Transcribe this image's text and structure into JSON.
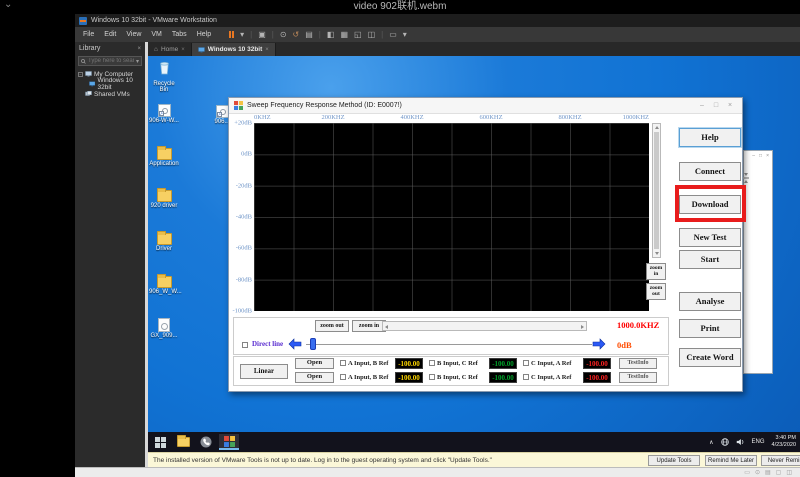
{
  "colors": {
    "desktop_blue": "#1173d4",
    "annotation_red": "#e81c1c",
    "readout_freq_red": "#ff0000",
    "readout_db_orange": "#ff4b00",
    "value_yellow": "#ffd800",
    "value_green": "#00a32a",
    "value_red": "#ff2222",
    "direct_line_purple": "#5a2dd0",
    "nav_arrow_blue": "#2b59f5",
    "axis_label_blue": "#6f95c8",
    "notification_yellow": "#fbf7d8"
  },
  "icons": {
    "video_collapse": "⌄",
    "close": "×",
    "minimize": "–",
    "maximize": "□",
    "dropdown": "▾",
    "home": "⌂",
    "tree_collapse": "−",
    "tray_chevron": "∧"
  },
  "video": {
    "title": "video 902联机.webm"
  },
  "vmware": {
    "title": "Windows 10 32bit - VMware Workstation",
    "menu": [
      "File",
      "Edit",
      "View",
      "VM",
      "Tabs",
      "Help"
    ],
    "toolbar": [
      {
        "name": "suspend-button",
        "glyph": ""
      },
      {
        "name": "send-ctrl-alt-del-icon",
        "glyph": "▣"
      },
      {
        "name": "take-snapshot-icon",
        "glyph": "⊙"
      },
      {
        "name": "revert-snapshot-icon",
        "glyph": "↺"
      },
      {
        "name": "snapshot-manager-icon",
        "glyph": "▤"
      },
      {
        "name": "show-library-icon",
        "glyph": "◧"
      },
      {
        "name": "thumbnail-bar-icon",
        "glyph": "▦"
      },
      {
        "name": "fullscreen-icon",
        "glyph": "◱"
      },
      {
        "name": "unity-icon",
        "glyph": "◫"
      },
      {
        "name": "enhanced-keyboard-icon",
        "glyph": "▭"
      }
    ],
    "tabs": [
      {
        "label": "Home"
      },
      {
        "label": "Windows 10 32bit"
      }
    ],
    "library": {
      "header": "Library",
      "search_placeholder": "Type here to search",
      "tree": [
        {
          "label": "My Computer"
        },
        {
          "label": "Windows 10 32bit"
        },
        {
          "label": "Shared VMs"
        }
      ]
    }
  },
  "desktop": {
    "icons": [
      {
        "label": "Recycle Bin",
        "type": "recycle"
      },
      {
        "label": "906-W-W...",
        "type": "shortcut"
      },
      {
        "label": "Application",
        "type": "folder"
      },
      {
        "label": "920 driver",
        "type": "folder"
      },
      {
        "label": "Driver",
        "type": "folder"
      },
      {
        "label": "906_W_W...",
        "type": "folder"
      },
      {
        "label": "GX_909...",
        "type": "disc"
      }
    ],
    "extra_icon": {
      "label": "906...",
      "type": "shortcut"
    }
  },
  "app": {
    "title": "Sweep Frequency Response Method  (ID:  E0007!)",
    "chart": {
      "freq_labels": [
        "0KHZ",
        "200KHZ",
        "400KHZ",
        "600KHZ",
        "800KHZ",
        "1000KHZ"
      ],
      "db_labels": [
        "+20dB",
        "0dB",
        "-20dB",
        "-40dB",
        "-60dB",
        "-80dB",
        "-100dB"
      ]
    },
    "side_zoom": {
      "zoom_in": "zoom in",
      "zoom_out": "zoom out"
    },
    "controls": {
      "zoom_out": "zoom out",
      "zoom_in": "zoom in",
      "direct_line": "Direct line",
      "linear": "Linear",
      "open": "Open",
      "testinfo": "TestInfo"
    },
    "readout": {
      "freq": "1000.0KHZ",
      "db": "0dB"
    },
    "input_rows": [
      {
        "labels": [
          "A Input, B Ref",
          "B Input, C Ref",
          "C Input, A Ref"
        ],
        "values": [
          "-100.00",
          "-100.00",
          "-100.00"
        ]
      },
      {
        "labels": [
          "A Input, B Ref",
          "B Input, C Ref",
          "C Input, A Ref"
        ],
        "values": [
          "-100.00",
          "-100.00",
          "-100.00"
        ]
      }
    ],
    "buttons": [
      "Help",
      "Connect",
      "Download",
      "New Test",
      "Start",
      "Analyse",
      "Print",
      "Create Word"
    ]
  },
  "taskbar": {
    "tray": {
      "lang": "ENG",
      "time": "3:40 PM",
      "date": "4/23/2020"
    }
  },
  "notification": {
    "text": "The installed version of VMware Tools is not up to date. Log in to the guest operating system and click \"Update Tools.\"",
    "buttons": [
      "Update Tools",
      "Remind Me Later",
      "Never Remind"
    ]
  }
}
